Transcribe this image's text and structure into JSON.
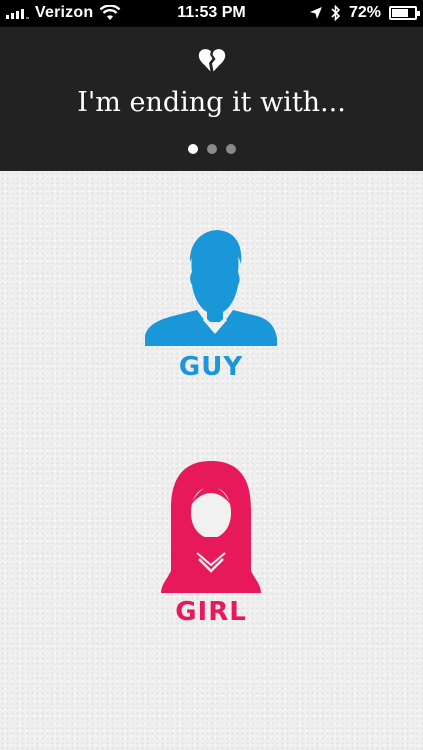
{
  "status_bar": {
    "carrier": "Verizon",
    "time": "11:53 PM",
    "battery": "72%",
    "battery_level": 0.72,
    "icons": [
      "signal-icon",
      "wifi-icon",
      "location-arrow-icon",
      "bluetooth-icon",
      "battery-icon"
    ]
  },
  "header": {
    "icon": "broken-heart-icon",
    "title": "I'm ending it with...",
    "page_indicator": {
      "total": 3,
      "current": 1
    }
  },
  "choices": {
    "guy": {
      "label": "GUY",
      "icon": "male-avatar-icon",
      "color": "#1a97d8"
    },
    "girl": {
      "label": "GIRL",
      "icon": "female-avatar-icon",
      "color": "#e8195a"
    }
  },
  "colors": {
    "header_bg": "#222222",
    "content_bg": "#efefef"
  }
}
